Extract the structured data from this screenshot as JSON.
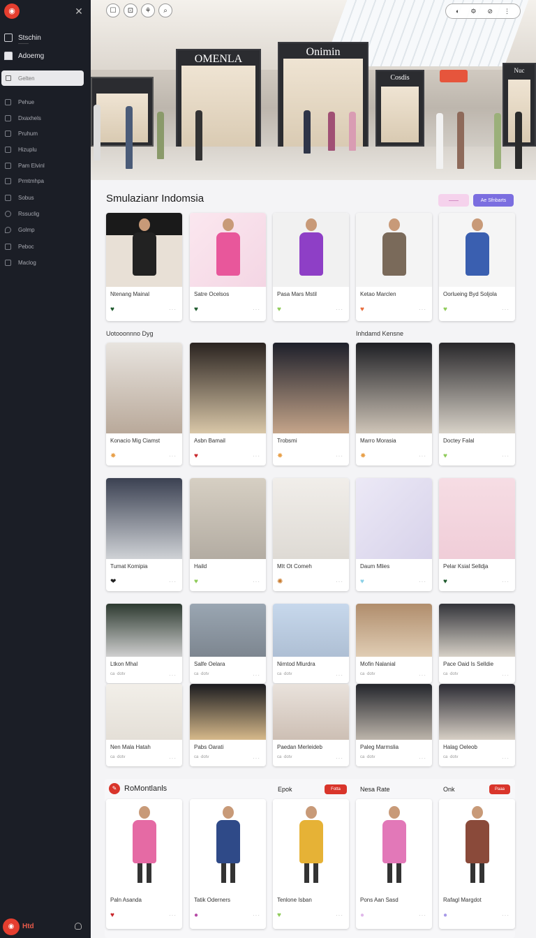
{
  "sidebar": {
    "logo": "◉",
    "primary": [
      {
        "label": "Stschin",
        "sub": "———",
        "icon": "inbox-icon"
      },
      {
        "label": "Adoemg",
        "icon": "home-icon"
      }
    ],
    "search_placeholder": "Gelten",
    "items": [
      "Pehue",
      "Dxaxhels",
      "Pruhum",
      "Hizuplu",
      "Pam Elvinl",
      "Prmtmhpa",
      "Sobus",
      "Rssuclig",
      "Golmp",
      "Peboc",
      "Maclog"
    ],
    "footer_label": "Htd"
  },
  "hero": {
    "store_signs": [
      "OMENLA",
      "Onimin",
      "Cosdis",
      "Nuc"
    ],
    "left_buttons": [
      "☐",
      "⊡",
      "⚘",
      "⌕"
    ],
    "right_buttons": [
      "◐",
      "⚙",
      "⊘",
      "⋮"
    ]
  },
  "main": {
    "title": "Smulazianr Indomsia",
    "top_buttons": [
      "——",
      "Ae Sfnbarts"
    ],
    "colors": {
      "accent": "#7b6ee0",
      "pink": "#f5d2ec",
      "brand": "#d9352b"
    },
    "row1": [
      {
        "caption": "Ntenang Mainal",
        "heart": "♥",
        "heart_color": "#1e5a2d"
      },
      {
        "caption": "Satre Ocelsos",
        "heart": "♥",
        "heart_color": "#1e5a2d"
      },
      {
        "caption": "Pasa Mars Mstil",
        "heart": "♥",
        "heart_color": "#8fcb5a"
      },
      {
        "caption": "Ketao Marclen",
        "heart": "♥",
        "heart_color": "#e86c3c"
      },
      {
        "caption": "Oorlueing Byd Soljola",
        "heart": "♥",
        "heart_color": "#8fcb5a"
      }
    ],
    "row_labels": [
      "Uotooonnno Dyg",
      "Inhdamd Kensne"
    ],
    "row2": [
      {
        "caption": "Konacio Mig Ciamst",
        "heart": "✸",
        "heart_color": "#e8a04a"
      },
      {
        "caption": "Asbn Bamail",
        "heart": "♥",
        "heart_color": "#c8252a"
      },
      {
        "caption": "Trobsmi",
        "heart": "✸",
        "heart_color": "#e8a04a"
      },
      {
        "caption": "Marro Morasia",
        "heart": "✸",
        "heart_color": "#e8a04a"
      },
      {
        "caption": "Doctey Falal",
        "heart": "♥",
        "heart_color": "#8fcb5a"
      }
    ],
    "row3": [
      {
        "caption": "Tumat Komipia",
        "heart": "❤",
        "heart_color": "#222"
      },
      {
        "caption": "Haild",
        "heart": "♥",
        "heart_color": "#8fcb5a"
      },
      {
        "caption": "MIt Ot Comeh",
        "heart": "✺",
        "heart_color": "#c8792a"
      },
      {
        "caption": "Daum Mlies",
        "heart": "♥",
        "heart_color": "#8ad0e6"
      },
      {
        "caption": "Pelar Ksial Selldja",
        "heart": "♥",
        "heart_color": "#1e5a2d"
      }
    ],
    "row4": [
      {
        "caption": "Ltkon Mhal",
        "sub": "ca ·dotv"
      },
      {
        "caption": "Salfe Oelara",
        "sub": "ca ·dotv"
      },
      {
        "caption": "Nimtod Mlurdra",
        "sub": "ca ·dotv"
      },
      {
        "caption": "Mofin Nalanial",
        "sub": "ca ·dotv"
      },
      {
        "caption": "Pace Oaid Is Selldie",
        "sub": "ca ·dotv"
      }
    ],
    "row5": [
      {
        "caption": "Nen Mala Hatah",
        "sub": "ca ·dotv"
      },
      {
        "caption": "Pabs Oarati",
        "sub": "ca ·dotv"
      },
      {
        "caption": "Paedan Merleideb",
        "sub": "ca ·dotv"
      },
      {
        "caption": "Paleg Marmslia",
        "sub": "ca ·dotv"
      },
      {
        "caption": "Halag Oeleob",
        "sub": "ca ·dotv"
      }
    ],
    "recommend": {
      "title": "RoMontlanls",
      "labels": [
        "Epok",
        "Nesa Rate",
        "Onk"
      ],
      "badges": [
        "Fotta",
        "Paaa"
      ],
      "cards": [
        {
          "caption": "Paln Asanda",
          "heart": "♥",
          "heart_color": "#c8252a"
        },
        {
          "caption": "Tatik Oderners",
          "heart": "●",
          "heart_color": "#b64aa6"
        },
        {
          "caption": "Tenlone Isban",
          "heart": "♥",
          "heart_color": "#8fcb5a"
        },
        {
          "caption": "Pons Aan Sasd",
          "heart": "●",
          "heart_color": "#e0b8ea"
        },
        {
          "caption": "Rafagl Margdot",
          "heart": "●",
          "heart_color": "#a89ae8"
        }
      ]
    }
  }
}
